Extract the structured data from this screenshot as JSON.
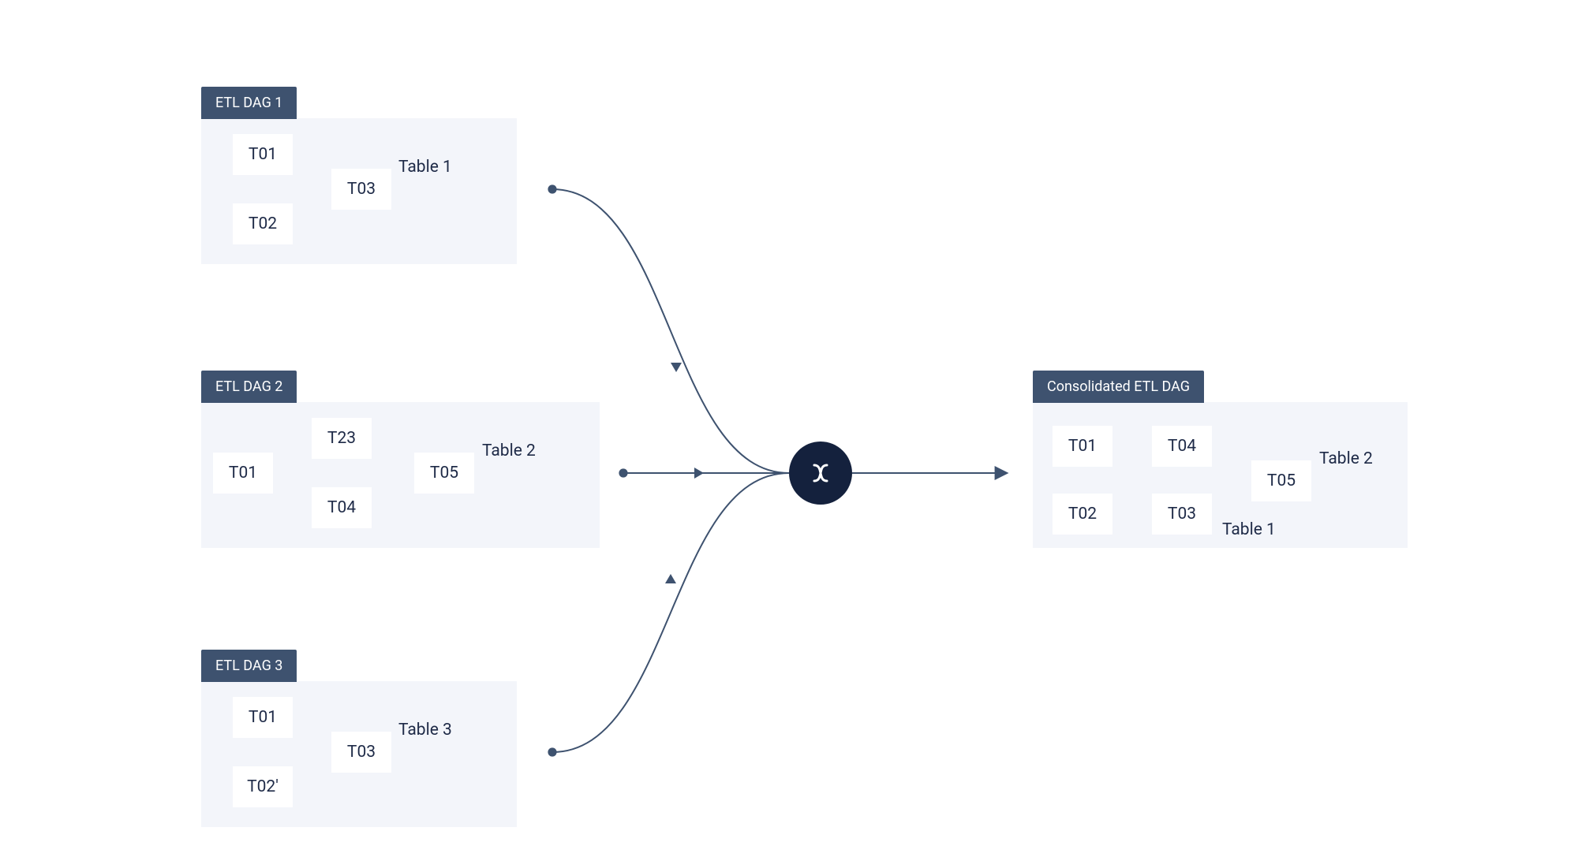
{
  "colors": {
    "panel_bg": "#f3f5fa",
    "header_bg": "#3e526f",
    "header_text": "#ffffff",
    "node_bg": "#ffffff",
    "edge": "#3e526f",
    "hub_bg": "#14213d"
  },
  "dags": {
    "dag1": {
      "title": "ETL DAG 1",
      "nodes": {
        "n1": "T01",
        "n2": "T02",
        "n3": "T03"
      },
      "output": "Table 1"
    },
    "dag2": {
      "title": "ETL DAG 2",
      "nodes": {
        "n1": "T01",
        "n2": "T23",
        "n3": "T04",
        "n4": "T05"
      },
      "output": "Table 2"
    },
    "dag3": {
      "title": "ETL DAG 3",
      "nodes": {
        "n1": "T01",
        "n2": "T02'",
        "n3": "T03"
      },
      "output": "Table 3"
    },
    "consolidated": {
      "title": "Consolidated ETL DAG",
      "nodes": {
        "n1": "T01",
        "n2": "T02",
        "n3": "T04",
        "n4": "T03",
        "n5": "T05"
      },
      "outputs": {
        "o1": "Table 2",
        "o2": "Table 1"
      }
    }
  },
  "hub": {
    "icon_name": "merge-icon"
  }
}
